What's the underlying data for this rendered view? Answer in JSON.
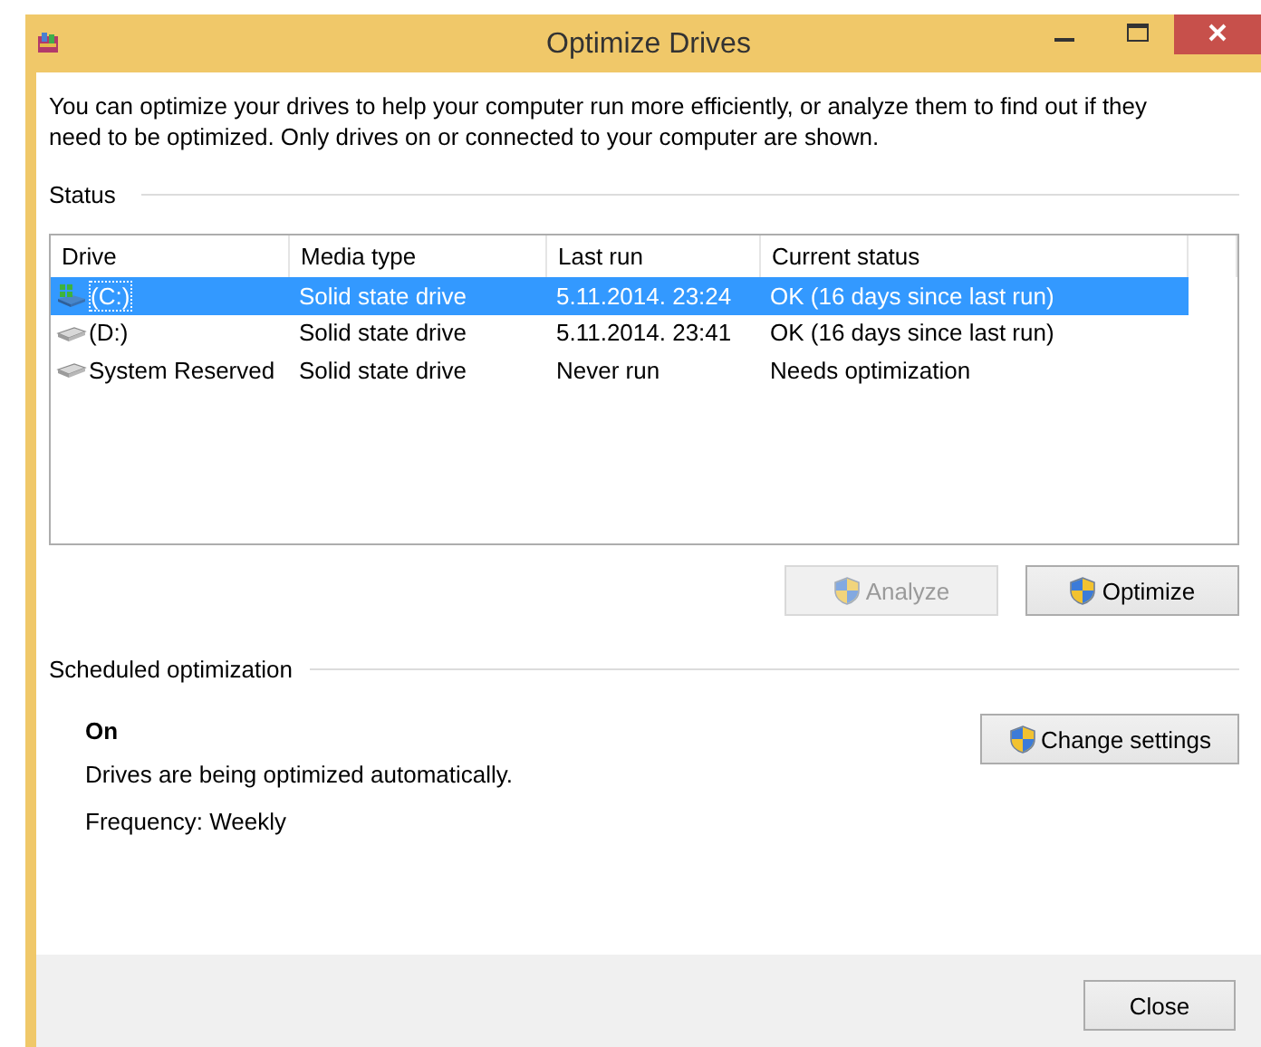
{
  "window": {
    "title": "Optimize Drives"
  },
  "description": "You can optimize your drives to help your computer run more efficiently, or analyze them to find out if they need to be optimized. Only drives on or connected to your computer are shown.",
  "status": {
    "label": "Status",
    "table": {
      "columns": [
        "Drive",
        "Media type",
        "Last run",
        "Current status"
      ],
      "rows": [
        {
          "drive": "(C:)",
          "kind": "system",
          "media_type": "Solid state drive",
          "last_run": "5.11.2014. 23:24",
          "current_status": "OK (16 days since last run)",
          "selected": true
        },
        {
          "drive": "(D:)",
          "kind": "disk",
          "media_type": "Solid state drive",
          "last_run": "5.11.2014. 23:41",
          "current_status": "OK (16 days since last run)",
          "selected": false
        },
        {
          "drive": "System Reserved",
          "kind": "disk",
          "media_type": "Solid state drive",
          "last_run": "Never run",
          "current_status": "Needs optimization",
          "selected": false
        }
      ]
    }
  },
  "actions": [
    {
      "label": "Analyze",
      "disabled": true
    },
    {
      "label": "Optimize",
      "disabled": false
    }
  ],
  "schedule": {
    "label": "Scheduled optimization",
    "state": "On",
    "description": "Drives are being optimized automatically.",
    "frequency": "Frequency: Weekly",
    "button": "Change settings"
  },
  "footer_buttons": [
    "Close"
  ]
}
